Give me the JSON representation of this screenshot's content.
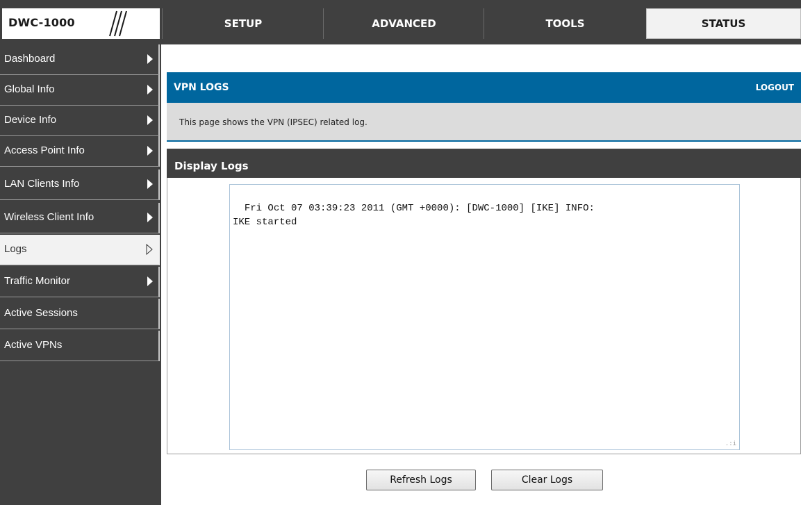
{
  "brand": {
    "name": "DWC-1000"
  },
  "nav": {
    "tabs": [
      {
        "label": "SETUP"
      },
      {
        "label": "ADVANCED"
      },
      {
        "label": "TOOLS"
      },
      {
        "label": "STATUS",
        "active": true
      }
    ]
  },
  "sidebar": {
    "items": [
      {
        "label": "Dashboard",
        "icon": "triangle-right-icon"
      },
      {
        "label": "Global Info",
        "icon": "triangle-right-icon"
      },
      {
        "label": "Device Info",
        "icon": "triangle-right-icon"
      },
      {
        "label": "Access Point Info",
        "icon": "triangle-right-icon"
      },
      {
        "label": "LAN Clients Info",
        "icon": "triangle-right-icon"
      },
      {
        "label": "Wireless Client Info",
        "icon": "triangle-right-icon"
      },
      {
        "label": "Logs",
        "icon": "triangle-right-outline-icon",
        "active": true
      },
      {
        "label": "Traffic Monitor",
        "icon": "triangle-right-icon"
      },
      {
        "label": "Active Sessions"
      },
      {
        "label": "Active VPNs"
      }
    ]
  },
  "page": {
    "title": "VPN LOGS",
    "logout": "LOGOUT",
    "description": "This page shows the VPN (IPSEC) related log."
  },
  "logs": {
    "section_title": "Display Logs",
    "content": "Fri Oct 07 03:39:23 2011 (GMT +0000): [DWC-1000] [IKE] INFO:\nIKE started"
  },
  "buttons": {
    "refresh": "Refresh Logs",
    "clear": "Clear Logs"
  },
  "colors": {
    "header_blue": "#00669e",
    "dark_bg": "#404040",
    "desc_bg": "#dcdcdc"
  }
}
